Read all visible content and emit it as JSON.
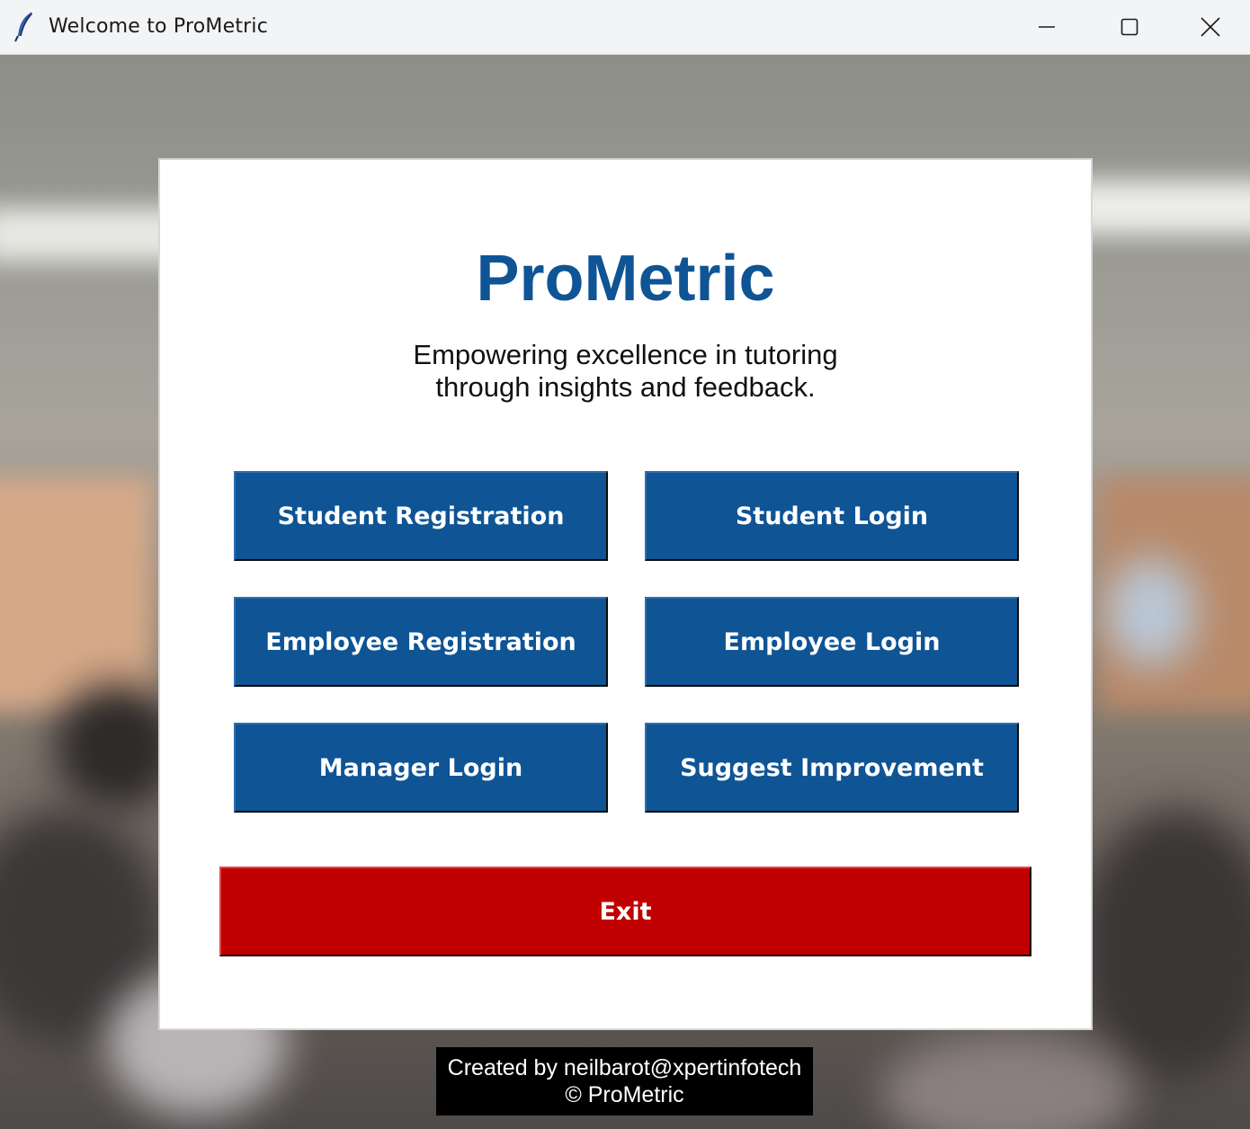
{
  "window": {
    "title": "Welcome to ProMetric"
  },
  "colors": {
    "primary_button": "#0f5494",
    "exit_button": "#c00000",
    "title_color": "#0f5494"
  },
  "card": {
    "title": "ProMetric",
    "tagline": "Empowering excellence in tutoring\nthrough insights and feedback."
  },
  "buttons": {
    "student_registration": "Student Registration",
    "student_login": "Student Login",
    "employee_registration": "Employee Registration",
    "employee_login": "Employee Login",
    "manager_login": "Manager Login",
    "suggest_improvement": "Suggest Improvement",
    "exit": "Exit"
  },
  "footer": {
    "line1": "Created by neilbarot@xpertinfotech",
    "line2": "© ProMetric"
  },
  "icons": {
    "app": "feather-icon",
    "minimize": "minimize-icon",
    "maximize": "maximize-icon",
    "close": "close-icon"
  }
}
